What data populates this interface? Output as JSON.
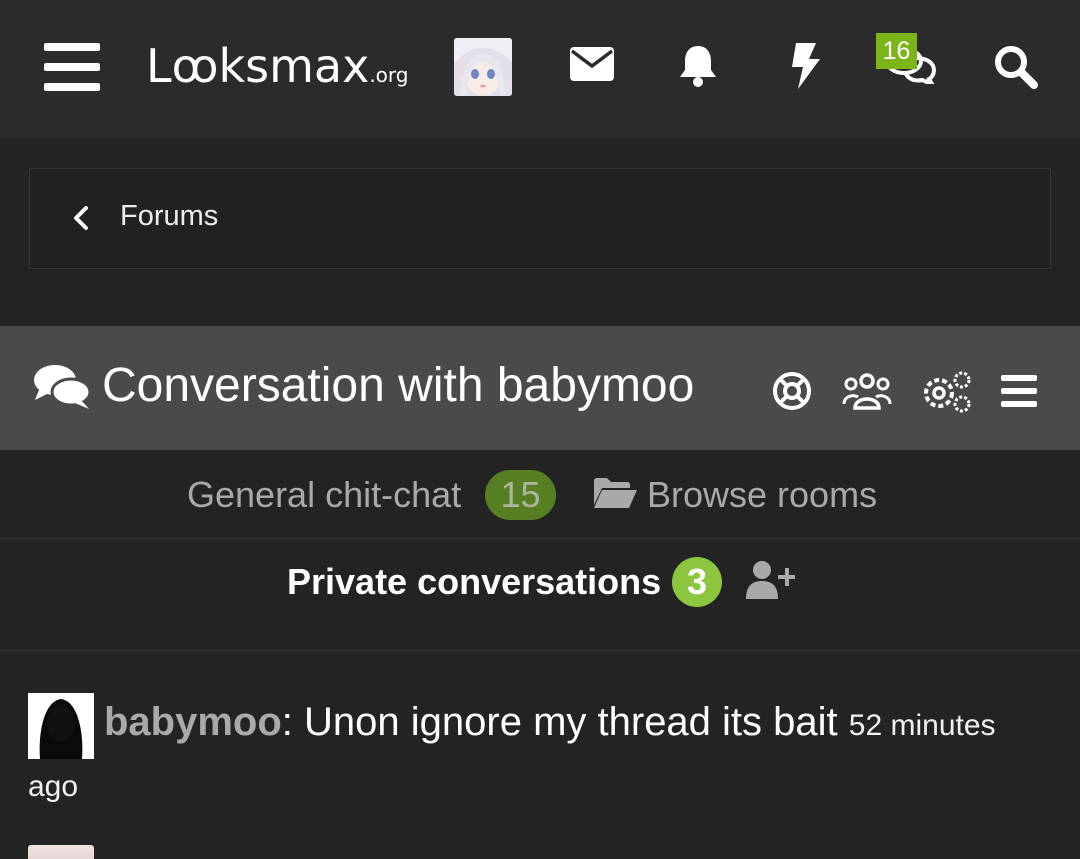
{
  "header": {
    "logo_main": "Lꝏksmax",
    "logo_suffix": ".org",
    "notification_badge": "16",
    "icons": [
      "menu-icon",
      "mail-icon",
      "bell-icon",
      "bolt-icon",
      "chat-icon",
      "search-icon"
    ]
  },
  "breadcrumb": {
    "label": "Forums"
  },
  "chat": {
    "title": "Conversation with babymoo",
    "title_icons": [
      "help-icon",
      "members-icon",
      "settings-icon",
      "menu-icon"
    ]
  },
  "rooms": {
    "general_label": "General chit-chat",
    "general_count": "15",
    "browse_label": "Browse rooms"
  },
  "private": {
    "label": "Private conversations",
    "count": "3"
  },
  "messages": [
    {
      "user": "babymoo",
      "sep": ": ",
      "text": "Unon ignore my thread its bait",
      "time": "52 minutes",
      "time_cont": "ago"
    }
  ],
  "colors": {
    "background": "#232323",
    "topbar": "#2b2b2b",
    "titlebar": "#4a4a4a",
    "accent_green": "#8cc63f",
    "muted_green": "#567f24"
  }
}
